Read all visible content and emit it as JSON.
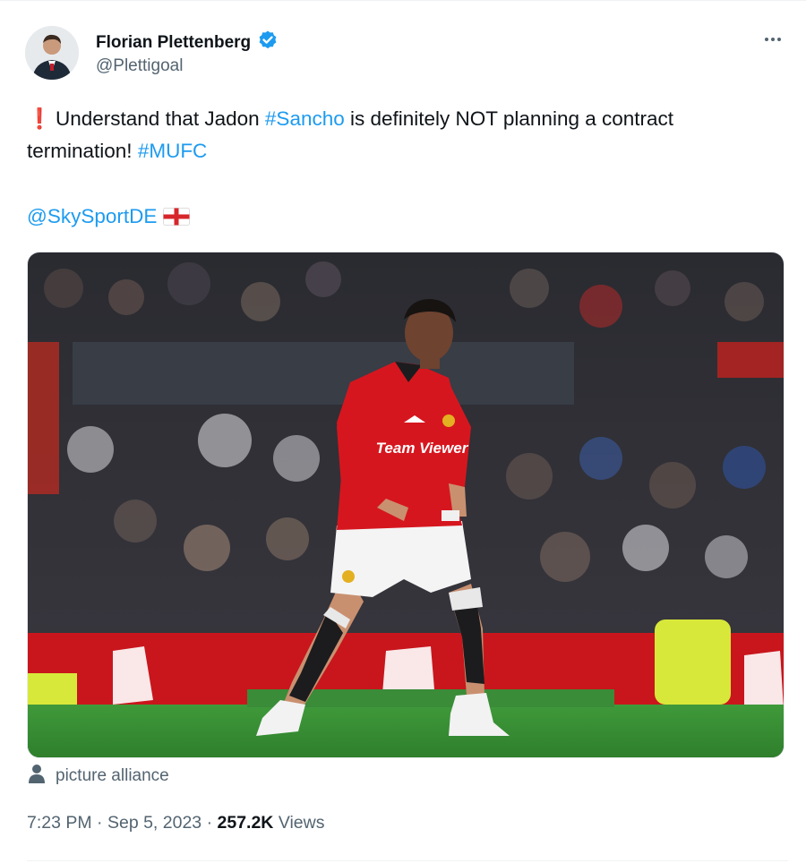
{
  "author": {
    "name": "Florian Plettenberg",
    "handle": "@Plettigoal",
    "verified": true,
    "verified_color": "#1d9bf0"
  },
  "tweet": {
    "line1_prefix": "Understand that Jadon ",
    "hashtag_sancho": "#Sancho",
    "line1_suffix": " is definitely NOT planning a contract",
    "line2_prefix": "termination! ",
    "hashtag_mufc": "#MUFC",
    "mention": "@SkySportDE",
    "exclamation_emoji": "❗",
    "flag_emoji": "england-flag"
  },
  "media": {
    "shirt_sponsor": "Team Viewer"
  },
  "credit": {
    "icon": "person-icon",
    "text": "picture alliance"
  },
  "meta": {
    "time": "7:23 PM",
    "separator": "·",
    "date": "Sep 5, 2023",
    "views_count": "257.2K",
    "views_label": "Views"
  },
  "colors": {
    "link": "#1d9bf0",
    "secondary_text": "#536471",
    "primary_text": "#0f1419"
  }
}
